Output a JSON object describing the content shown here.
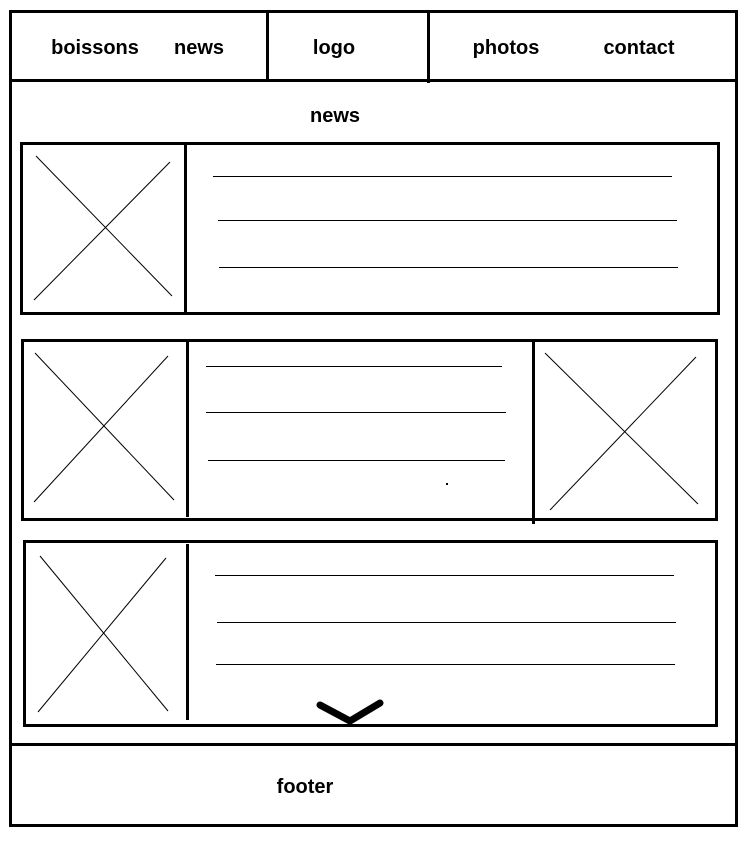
{
  "nav": {
    "items": [
      {
        "label": "boissons"
      },
      {
        "label": "news"
      },
      {
        "label": "logo"
      },
      {
        "label": "photos"
      },
      {
        "label": "contact"
      }
    ]
  },
  "main": {
    "title": "news"
  },
  "footer": {
    "label": "footer"
  },
  "icons": {
    "image_placeholder": "x-cross-icon",
    "scroll_indicator": "chevron-down-icon"
  }
}
